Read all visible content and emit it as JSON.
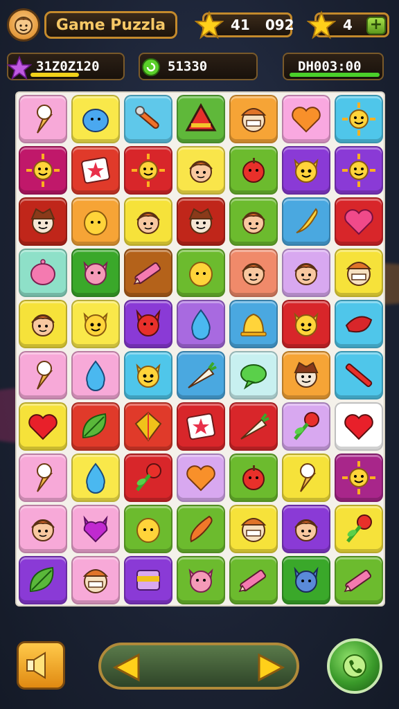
{
  "header": {
    "title": "Game Puzzla",
    "stars": {
      "value": "41",
      "extra": "092"
    },
    "lives": "4",
    "plus_label": "+"
  },
  "stats": {
    "score": "31Z0Z120",
    "coins": "51330",
    "timer": "DH003:00"
  },
  "board": {
    "rows": [
      [
        {
          "bg": "#f7a9d8",
          "icon": "ice-cream-icon"
        },
        {
          "bg": "#f9e84a",
          "icon": "blue-blob-icon"
        },
        {
          "bg": "#5fc8ea",
          "icon": "wrench-icon"
        },
        {
          "bg": "#5fb83a",
          "icon": "triangle-icon"
        },
        {
          "bg": "#f6a436",
          "icon": "cat-face-icon"
        },
        {
          "bg": "#f9a8e0",
          "icon": "heart-orange-icon"
        },
        {
          "bg": "#4fc6ea",
          "icon": "sun-face-icon"
        }
      ],
      [
        {
          "bg": "#c0186a",
          "icon": "sun-face-icon"
        },
        {
          "bg": "#e03a2a",
          "icon": "star-card-icon"
        },
        {
          "bg": "#d8262a",
          "icon": "sun-face-icon"
        },
        {
          "bg": "#f9e54a",
          "icon": "girl-face-icon"
        },
        {
          "bg": "#6cbb2e",
          "icon": "red-apple-icon"
        },
        {
          "bg": "#8a3ad6",
          "icon": "cat-face-yellow-icon"
        },
        {
          "bg": "#8a3ad6",
          "icon": "sun-face-icon"
        }
      ],
      [
        {
          "bg": "#c0261a",
          "icon": "boy-face-icon"
        },
        {
          "bg": "#f6a436",
          "icon": "yellow-blob-icon"
        },
        {
          "bg": "#f6e23a",
          "icon": "girl-face-icon"
        },
        {
          "bg": "#c0261a",
          "icon": "boy-face-icon"
        },
        {
          "bg": "#6cbb2e",
          "icon": "girl-face-icon"
        },
        {
          "bg": "#4aa8e0",
          "icon": "banana-icon"
        },
        {
          "bg": "#d8262a",
          "icon": "heart-pink-icon"
        }
      ],
      [
        {
          "bg": "#8ee0c8",
          "icon": "pink-blob-icon"
        },
        {
          "bg": "#3aa82a",
          "icon": "pig-face-icon"
        },
        {
          "bg": "#b4621a",
          "icon": "pencil-icon"
        },
        {
          "bg": "#6cbb2e",
          "icon": "yellow-blob-icon"
        },
        {
          "bg": "#f08a6a",
          "icon": "girl-face-icon"
        },
        {
          "bg": "#d8a8f0",
          "icon": "girl-face-icon"
        },
        {
          "bg": "#f6e23a",
          "icon": "cat-face-icon"
        }
      ],
      [
        {
          "bg": "#f6e23a",
          "icon": "girl-face-icon"
        },
        {
          "bg": "#f9e84a",
          "icon": "cat-face-yellow-icon"
        },
        {
          "bg": "#8a3ad6",
          "icon": "devil-face-icon"
        },
        {
          "bg": "#a86ae0",
          "icon": "blue-drop-icon"
        },
        {
          "bg": "#4aa8e0",
          "icon": "bell-icon"
        },
        {
          "bg": "#d8262a",
          "icon": "cat-face-yellow-icon"
        },
        {
          "bg": "#4fc6ea",
          "icon": "lips-icon"
        }
      ],
      [
        {
          "bg": "#f7a9d8",
          "icon": "ice-cream-icon"
        },
        {
          "bg": "#f7a9d8",
          "icon": "blue-drop-icon"
        },
        {
          "bg": "#4fc6ea",
          "icon": "cat-face-yellow-icon"
        },
        {
          "bg": "#4aa8e0",
          "icon": "carrot-icon"
        },
        {
          "bg": "#c8f0f0",
          "icon": "green-bubble-icon"
        },
        {
          "bg": "#f6a436",
          "icon": "boy-face-icon"
        },
        {
          "bg": "#4fc6ea",
          "icon": "pen-icon"
        }
      ],
      [
        {
          "bg": "#f6e23a",
          "icon": "heart-red-icon"
        },
        {
          "bg": "#e03a2a",
          "icon": "leaf-icon"
        },
        {
          "bg": "#e03a2a",
          "icon": "kite-icon"
        },
        {
          "bg": "#d8262a",
          "icon": "star-card-icon"
        },
        {
          "bg": "#d8262a",
          "icon": "carrot-icon"
        },
        {
          "bg": "#d8a8f0",
          "icon": "flower-icon"
        },
        {
          "bg": "#ffffff",
          "icon": "heart-red-icon"
        }
      ],
      [
        {
          "bg": "#f7a9d8",
          "icon": "ice-cream-icon"
        },
        {
          "bg": "#f9e84a",
          "icon": "blue-drop-icon"
        },
        {
          "bg": "#d8262a",
          "icon": "flower-icon"
        },
        {
          "bg": "#d8a8f0",
          "icon": "heart-orange-icon"
        },
        {
          "bg": "#6cbb2e",
          "icon": "red-apple-icon"
        },
        {
          "bg": "#f6e23a",
          "icon": "ice-cream-icon"
        },
        {
          "bg": "#a8268a",
          "icon": "sun-face-icon"
        }
      ],
      [
        {
          "bg": "#f7a9d8",
          "icon": "girl-face-icon"
        },
        {
          "bg": "#f7a9d8",
          "icon": "purple-cat-icon"
        },
        {
          "bg": "#6cbb2e",
          "icon": "yellow-blob-icon"
        },
        {
          "bg": "#6cbb2e",
          "icon": "chili-icon"
        },
        {
          "bg": "#f6e23a",
          "icon": "cat-face-icon"
        },
        {
          "bg": "#8a3ad6",
          "icon": "girl-face-icon"
        },
        {
          "bg": "#f6e23a",
          "icon": "flower-icon"
        }
      ],
      [
        {
          "bg": "#8a3ad6",
          "icon": "leaf-icon"
        },
        {
          "bg": "#f7a9d8",
          "icon": "cat-face-icon"
        },
        {
          "bg": "#8a3ad6",
          "icon": "cup-icon"
        },
        {
          "bg": "#6cbb2e",
          "icon": "pig-face-icon"
        },
        {
          "bg": "#6cbb2e",
          "icon": "pencil-icon"
        },
        {
          "bg": "#3aa82a",
          "icon": "blue-cat-icon"
        },
        {
          "bg": "#6cbb2e",
          "icon": "pencil-icon"
        }
      ]
    ]
  },
  "colors": {
    "accent_gold": "#c48a2c",
    "score_bar": "#f2d21a",
    "coins_bar": "#3aa82a",
    "timer_bar": "#4ad02a"
  }
}
